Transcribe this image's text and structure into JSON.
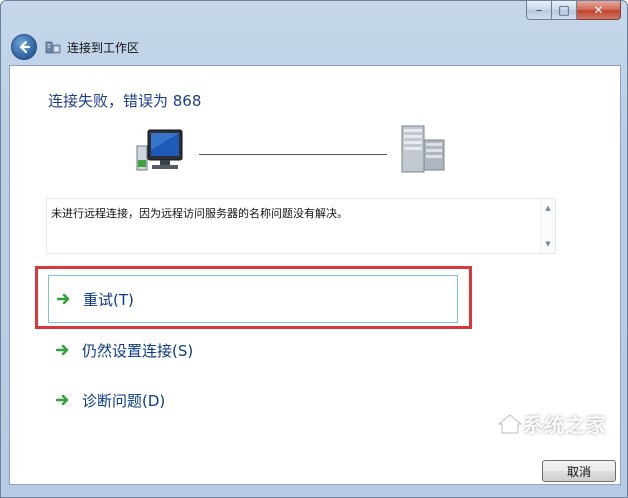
{
  "window": {
    "caption_buttons": {
      "minimize": "–",
      "maximize": "□",
      "close": "✕"
    },
    "nav_title": "连接到工作区",
    "back_icon": "back-arrow-icon"
  },
  "main": {
    "heading": "连接失败，错误为 868",
    "message": "未进行远程连接，因为远程访问服务器的名称问题没有解决。",
    "commands": [
      {
        "label": "重试(T)",
        "selected": true
      },
      {
        "label": "仍然设置连接(S)",
        "selected": false
      },
      {
        "label": "诊断问题(D)",
        "selected": false
      }
    ],
    "cancel_label": "取消"
  },
  "watermark": "系统之家",
  "colors": {
    "heading": "#1e3d8f",
    "command_text": "#0a3a8a",
    "arrow_green": "#2fa33a",
    "highlight_red": "#d9383b"
  }
}
